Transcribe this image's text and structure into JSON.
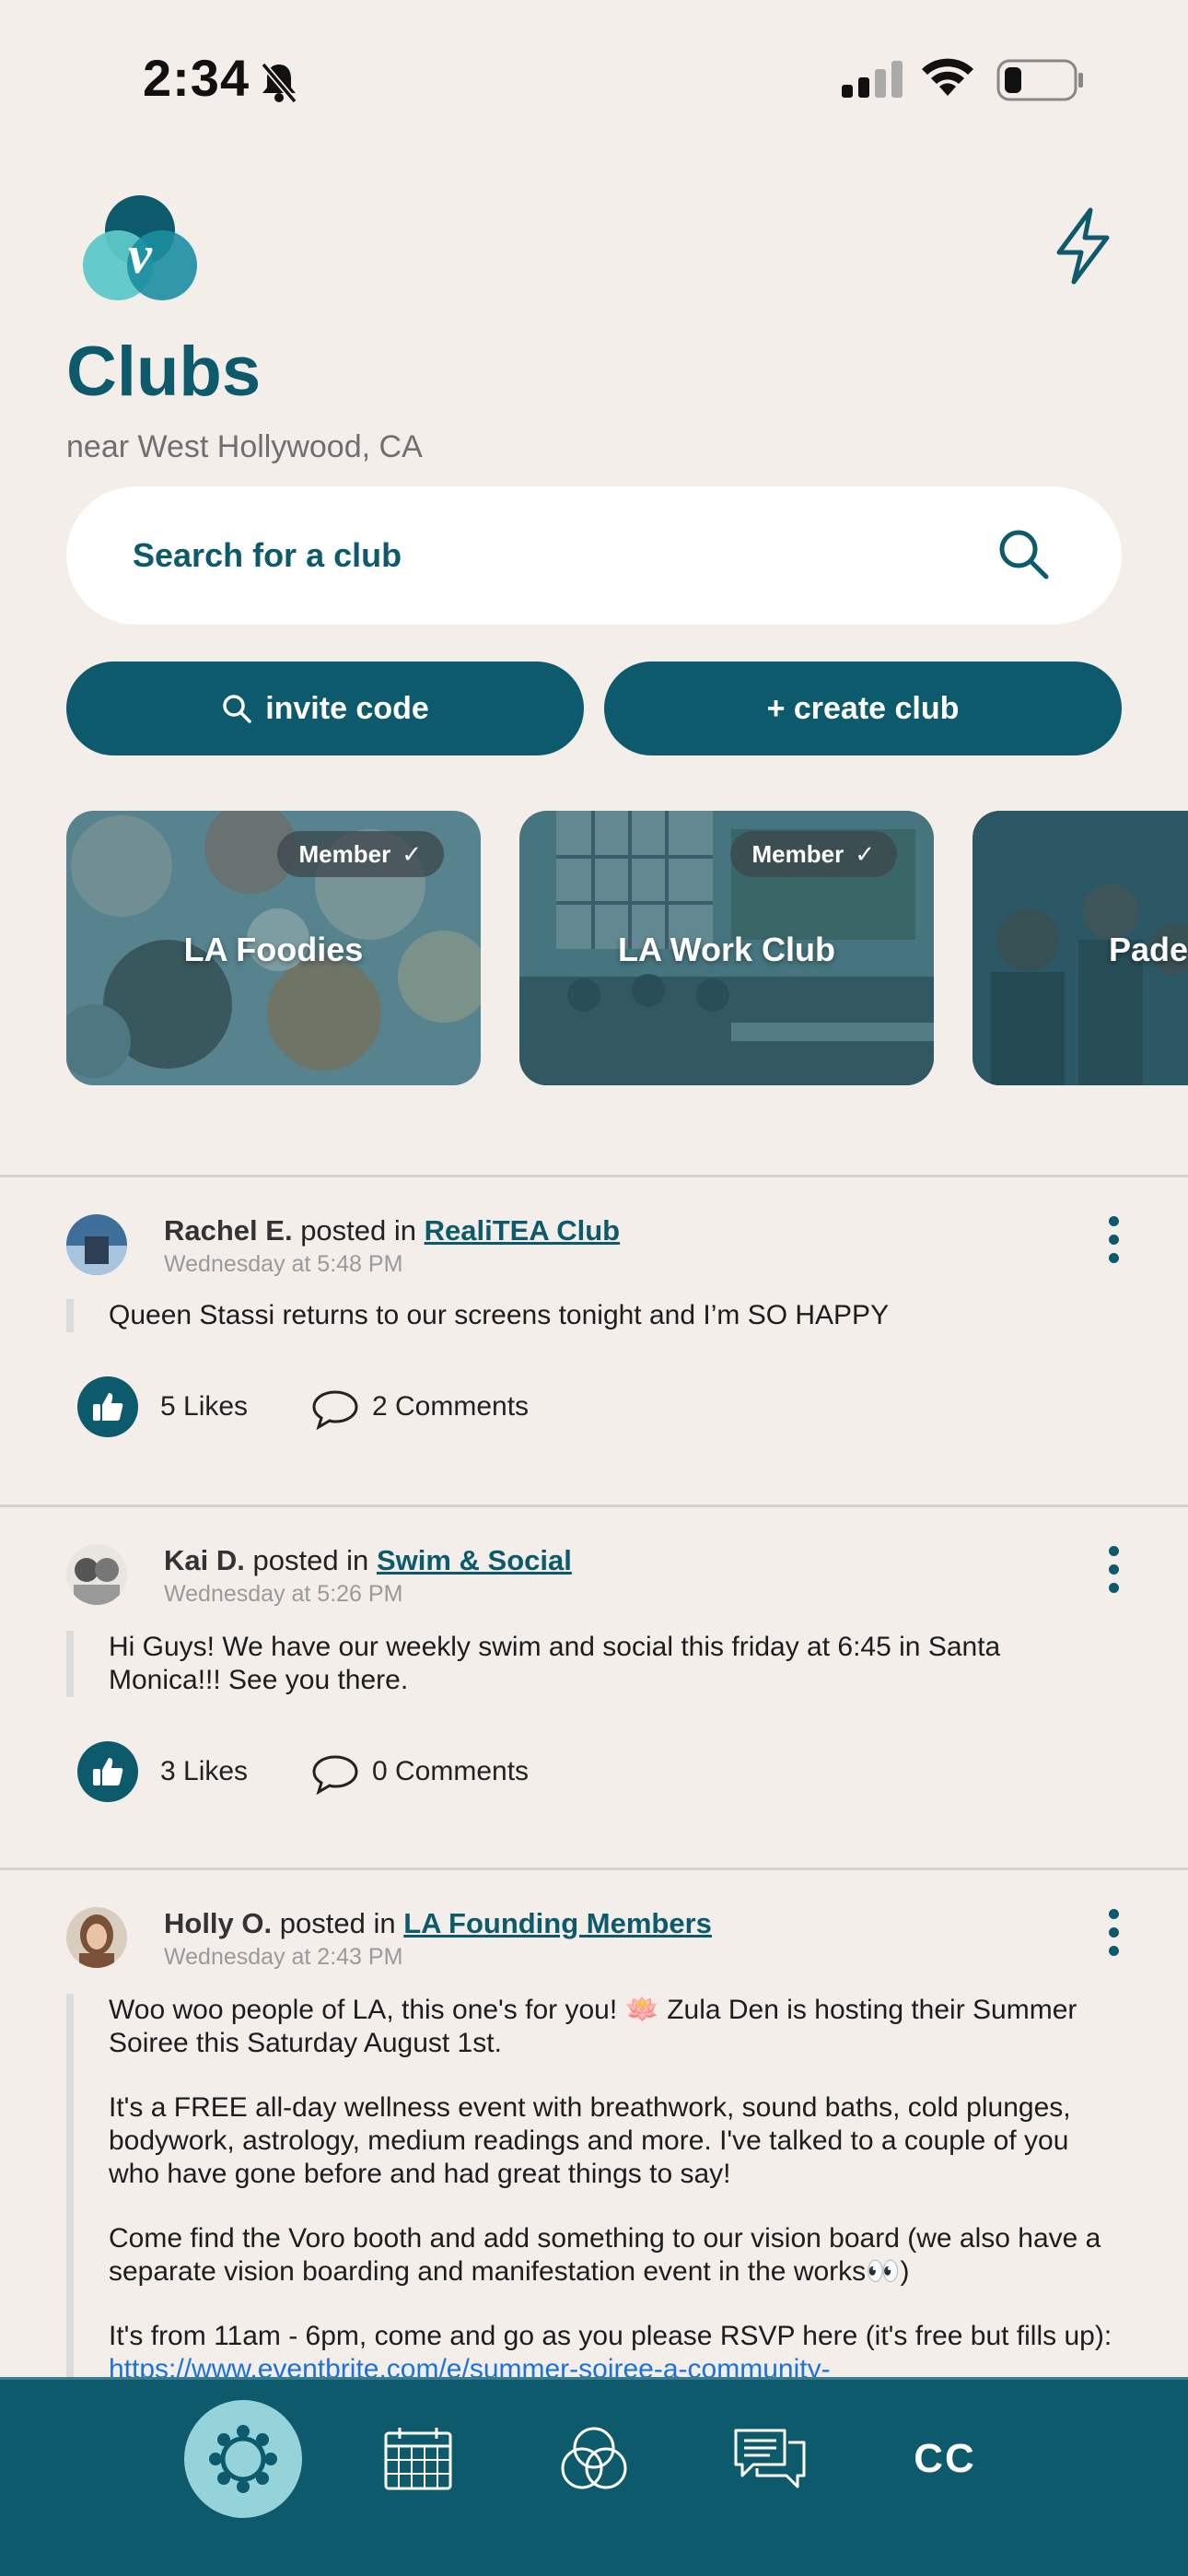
{
  "status_bar": {
    "time": "2:34"
  },
  "header": {
    "title": "Clubs",
    "location": "near West Hollywood, CA"
  },
  "search": {
    "placeholder": "Search for a club"
  },
  "actions": {
    "invite_label": "invite code",
    "create_label": "+ create club"
  },
  "clubs": [
    {
      "name": "LA Foodies",
      "badge": "Member",
      "member": true
    },
    {
      "name": "LA Work Club",
      "badge": "Member",
      "member": true
    },
    {
      "name": "Pade",
      "member": false
    }
  ],
  "posts": [
    {
      "author": "Rachel E.",
      "posted_in": "posted in",
      "club": "RealiTEA Club",
      "time": "Wednesday at 5:48 PM",
      "body": [
        "Queen Stassi returns to our screens tonight and I’m SO HAPPY"
      ],
      "likes": "5 Likes",
      "comments": "2 Comments"
    },
    {
      "author": "Kai D.",
      "posted_in": "posted in",
      "club": "Swim & Social",
      "time": "Wednesday at 5:26 PM",
      "body": [
        "Hi Guys! We have our weekly swim and social this friday at 6:45 in Santa Monica!!! See you there."
      ],
      "likes": "3 Likes",
      "comments": "0 Comments"
    },
    {
      "author": "Holly O.",
      "posted_in": "posted in",
      "club": "LA Founding Members",
      "time": "Wednesday at 2:43 PM",
      "body": [
        "Woo woo people of LA, this one's for you! 🪷 Zula Den is hosting their Summer Soiree this Saturday August 1st.",
        "It's a FREE all-day wellness event with breathwork, sound baths, cold plunges, bodywork, astrology, medium readings and more. I've talked to a couple of you who have gone before and had great things to say!",
        "Come find the Voro booth and add something to our vision board (we also have a separate vision boarding and manifestation event in the works👀)",
        "It's from 11am - 6pm, come and go as you please  RSVP here (it's free but fills up): "
      ],
      "link": "https://www.eventbrite.com/e/summer-soiree-a-community-"
    }
  ],
  "nav": {
    "cc_label": "CC"
  },
  "colors": {
    "primary": "#0d5a6c",
    "background": "#f3eee9",
    "active_nav": "#93d3d9",
    "link": "#1a73d9"
  }
}
